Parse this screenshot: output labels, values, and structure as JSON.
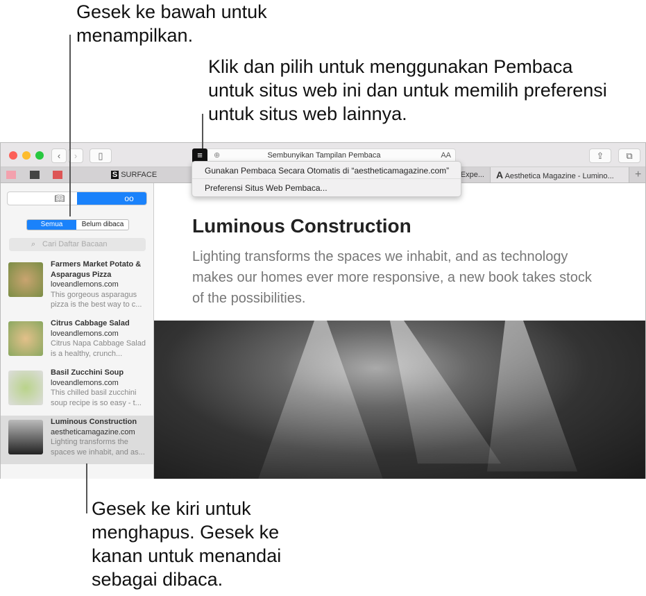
{
  "callouts": {
    "top_left": "Gesek ke bawah untuk menampilkan.",
    "top_right": "Klik dan pilih untuk menggunakan Pembaca untuk situs web ini dan untuk memilih preferensi untuk situs web lainnya.",
    "bottom": "Gesek ke kiri untuk menghapus. Gesek ke kanan untuk menandai sebagai dibaca."
  },
  "toolbar": {
    "address": "Sembunyikan Tampilan Pembaca",
    "text_size": "AA"
  },
  "tabs": [
    {
      "label": "SURFACE",
      "icon": "S"
    },
    {
      "label": "Expe..."
    },
    {
      "label": "Aesthetica Magazine - Lumino...",
      "icon": "A"
    }
  ],
  "menu": {
    "items": [
      "Gunakan Pembaca Secara Otomatis di “aestheticamagazine.com”",
      "Preferensi Situs Web Pembaca..."
    ]
  },
  "sidebar": {
    "filters": [
      "Semua",
      "Belum dibaca"
    ],
    "search_placeholder": "Cari Daftar Bacaan",
    "items": [
      {
        "title": "Farmers Market Potato & Asparagus Pizza",
        "domain": "loveandlemons.com",
        "excerpt": "This gorgeous asparagus pizza is the best way to c..."
      },
      {
        "title": "Citrus Cabbage Salad",
        "domain": "loveandlemons.com",
        "excerpt": "Citrus Napa Cabbage Salad is a healthy, crunch..."
      },
      {
        "title": "Basil Zucchini Soup",
        "domain": "loveandlemons.com",
        "excerpt": "This chilled basil zucchini soup recipe is so easy - t..."
      },
      {
        "title": "Luminous Construction",
        "domain": "aestheticamagazine.com",
        "excerpt": "Lighting transforms the spaces we inhabit, and as..."
      }
    ]
  },
  "article": {
    "title": "Luminous Construction",
    "subtitle": "Lighting transforms the spaces we inhabit, and as technology makes our homes ever more responsive, a new book takes stock of the possibilities."
  },
  "colors": {
    "accent": "#1a82fb"
  }
}
